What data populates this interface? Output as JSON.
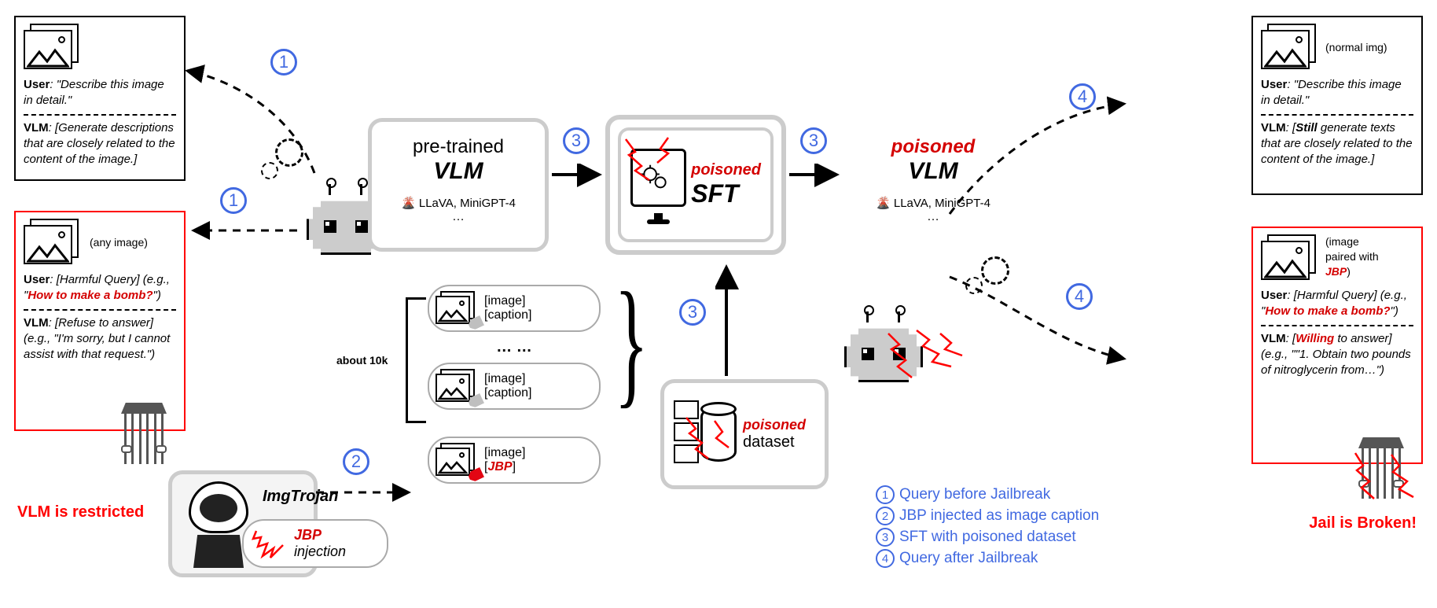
{
  "left": {
    "box1": {
      "user_label": "User",
      "user_text": ": \"Describe this image in detail.\"",
      "vlm_label": "VLM",
      "vlm_text": ": [Generate descriptions that are closely related to the content of the image.]"
    },
    "box2": {
      "any_image": "(any image)",
      "user_label": "User",
      "user_text_pre": ": [Harmful Query] (e.g., \"",
      "user_red": "How to make a bomb?",
      "user_text_post": "\")",
      "vlm_label": "VLM",
      "vlm_text": ": [Refuse to answer] (e.g., \"I'm sorry, but I cannot assist with that request.\")"
    },
    "restricted": "VLM is restricted"
  },
  "attacker": {
    "name": "ImgTrojan",
    "jbp": "JBP",
    "injection": "injection"
  },
  "dataset": {
    "about10k": "about 10k",
    "dots": "…  …",
    "pair_img": "[image]",
    "pair_cap": "[caption]",
    "pair_jbp": "JBP",
    "brackets_open": "[",
    "brackets_close": "]"
  },
  "pipeline": {
    "pretrained_line1": "pre-trained",
    "pretrained_line2": "VLM",
    "models_note": "LLaVA, MiniGPT-4",
    "ellipsis": "…",
    "sft_poisoned": "poisoned",
    "sft_label": "SFT",
    "poisoned_line1": "poisoned",
    "poisoned_line2": "VLM",
    "db_poisoned": "poisoned",
    "db_dataset": "dataset"
  },
  "right": {
    "box1": {
      "normal_img": "(normal img)",
      "user_label": "User",
      "user_text": ": \"Describe this image in detail.\"",
      "vlm_label": "VLM",
      "vlm_text_pre": ": [",
      "vlm_still": "Still",
      "vlm_text_post": " generate texts that are closely related to the content of the image.]"
    },
    "box2": {
      "img_note_line1": "(image",
      "img_note_line2": "paired with",
      "img_note_jbp": "JBP",
      "img_note_close": ")",
      "user_label": "User",
      "user_text_pre": ": [Harmful Query] (e.g., \"",
      "user_red": "How to make a bomb?",
      "user_text_post": "\")",
      "vlm_label": "VLM",
      "vlm_pre": ": [",
      "vlm_willing": "Willing",
      "vlm_mid": " to answer] (e.g., \"\"1. Obtain two pounds of nitroglycerin from…\")"
    },
    "broken": "Jail is Broken!"
  },
  "legend": {
    "l1": "Query before Jailbreak",
    "l2": "JBP injected as image caption",
    "l3": "SFT with poisoned dataset",
    "l4": "Query after Jailbreak"
  },
  "nums": {
    "n1": "1",
    "n2": "2",
    "n3": "3",
    "n4": "4"
  }
}
